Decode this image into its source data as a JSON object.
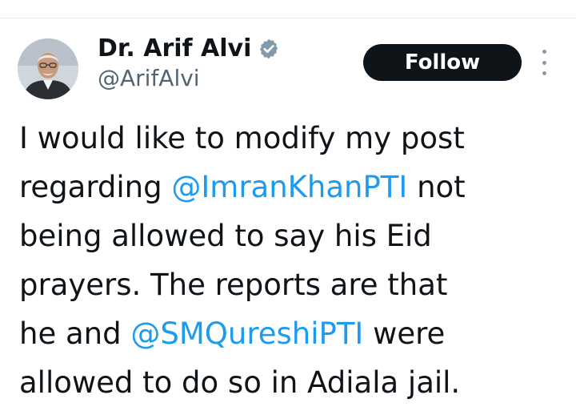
{
  "author": {
    "display_name": "Dr. Arif Alvi",
    "handle": "@ArifAlvi",
    "verified_icon": "verified-badge-icon",
    "avatar": "profile-photo"
  },
  "actions": {
    "follow_label": "Follow",
    "more_icon": "more-vertical-icon"
  },
  "tweet": {
    "lines": [
      [
        {
          "text": "I would like to modify my post",
          "mention": false
        }
      ],
      [
        {
          "text": "regarding ",
          "mention": false
        },
        {
          "text": "@ImranKhanPTI",
          "mention": true
        },
        {
          "text": " not",
          "mention": false
        }
      ],
      [
        {
          "text": "being allowed to say his Eid",
          "mention": false
        }
      ],
      [
        {
          "text": "prayers. The reports are that",
          "mention": false
        }
      ],
      [
        {
          "text": "he and ",
          "mention": false
        },
        {
          "text": "@SMQureshiPTI",
          "mention": true
        },
        {
          "text": " were",
          "mention": false
        }
      ],
      [
        {
          "text": "allowed to do so in Adiala jail.",
          "mention": false
        }
      ]
    ]
  },
  "colors": {
    "text": "#0f1419",
    "secondary": "#536471",
    "link": "#1d9bf0",
    "follow_bg": "#0f1419",
    "verified": "#829aab"
  }
}
